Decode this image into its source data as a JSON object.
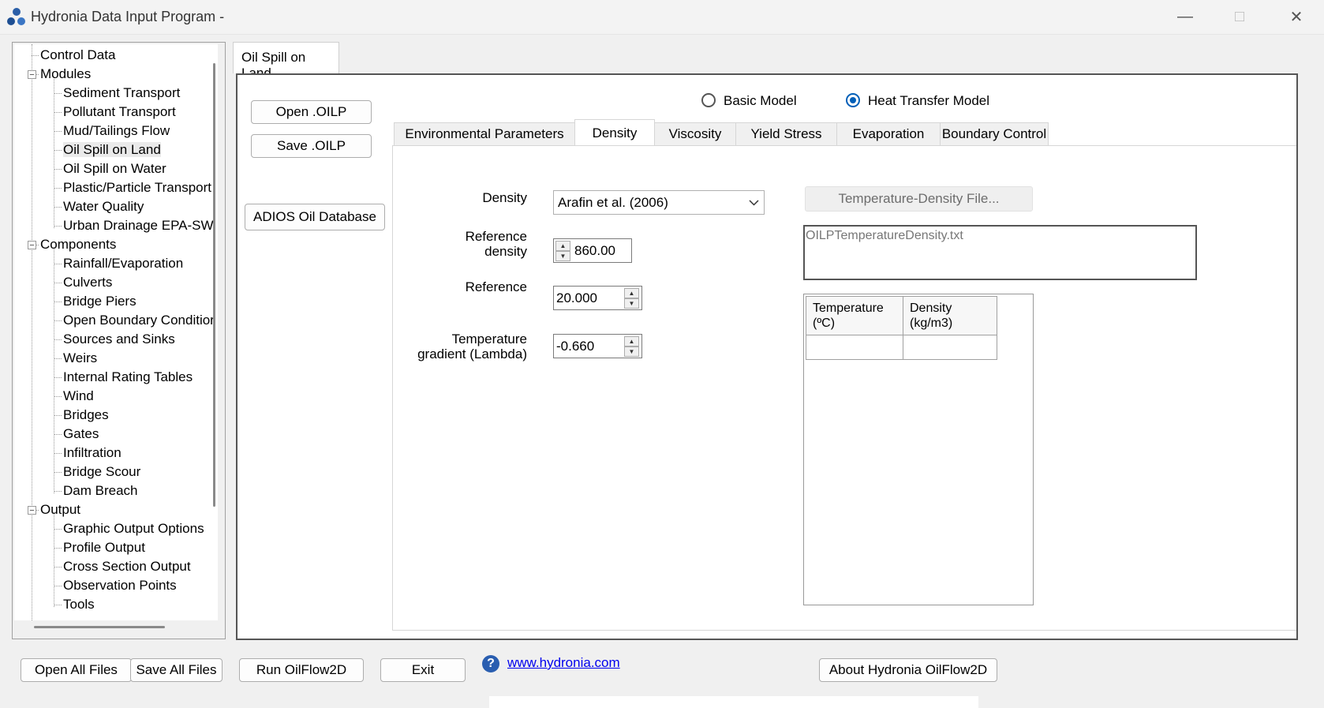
{
  "window": {
    "title": "Hydronia Data Input Program -"
  },
  "tree": [
    {
      "label": "Control Data",
      "level": 0,
      "expander": ""
    },
    {
      "label": "Modules",
      "level": 0,
      "expander": "−"
    },
    {
      "label": "Sediment Transport",
      "level": 1
    },
    {
      "label": "Pollutant Transport",
      "level": 1
    },
    {
      "label": "Mud/Tailings Flow",
      "level": 1
    },
    {
      "label": "Oil Spill on Land",
      "level": 1,
      "selected": true
    },
    {
      "label": "Oil Spill on Water",
      "level": 1
    },
    {
      "label": "Plastic/Particle Transport",
      "level": 1
    },
    {
      "label": "Water Quality",
      "level": 1
    },
    {
      "label": "Urban Drainage EPA-SW",
      "level": 1
    },
    {
      "label": "Components",
      "level": 0,
      "expander": "−"
    },
    {
      "label": "Rainfall/Evaporation",
      "level": 1
    },
    {
      "label": "Culverts",
      "level": 1
    },
    {
      "label": "Bridge Piers",
      "level": 1
    },
    {
      "label": "Open Boundary Conditior",
      "level": 1
    },
    {
      "label": "Sources and Sinks",
      "level": 1
    },
    {
      "label": "Weirs",
      "level": 1
    },
    {
      "label": "Internal Rating Tables",
      "level": 1
    },
    {
      "label": "Wind",
      "level": 1
    },
    {
      "label": "Bridges",
      "level": 1
    },
    {
      "label": "Gates",
      "level": 1
    },
    {
      "label": "Infiltration",
      "level": 1
    },
    {
      "label": "Bridge Scour",
      "level": 1
    },
    {
      "label": "Dam Breach",
      "level": 1
    },
    {
      "label": "Output",
      "level": 0,
      "expander": "−"
    },
    {
      "label": "Graphic Output Options",
      "level": 1
    },
    {
      "label": "Profile Output",
      "level": 1
    },
    {
      "label": "Cross Section Output",
      "level": 1
    },
    {
      "label": "Observation Points",
      "level": 1
    },
    {
      "label": "Tools",
      "level": 1
    }
  ],
  "main_tab": "Oil Spill on Land",
  "buttons": {
    "open_oilp": "Open .OILP",
    "save_oilp": "Save .OILP",
    "adios": "ADIOS Oil Database"
  },
  "model": {
    "basic": "Basic Model",
    "heat": "Heat Transfer Model",
    "selected": "heat"
  },
  "subtabs": [
    "Environmental Parameters",
    "Density",
    "Viscosity",
    "Yield Stress",
    "Evaporation",
    "Boundary Control"
  ],
  "active_subtab": "Density",
  "density": {
    "density_label": "Density",
    "density_value": "Arafin et al. (2006)",
    "ref_density_label_1": "Reference",
    "ref_density_label_2": "density",
    "ref_density_value": "860.00",
    "reference_label": "Reference",
    "reference_value": "20.000",
    "gradient_label_1": "Temperature",
    "gradient_label_2": "gradient (Lambda)",
    "gradient_value": "-0.660",
    "file_button": "Temperature-Density  File...",
    "file_name": "OILPTemperatureDensity.txt",
    "grid_headers": [
      {
        "line1": "Temperature",
        "line2": "(ºC)"
      },
      {
        "line1": "Density",
        "line2": "(kg/m3)"
      }
    ]
  },
  "footer": {
    "open_all": "Open All Files",
    "save_all": "Save All Files",
    "run": "Run OilFlow2D",
    "exit": "Exit",
    "link": "www.hydronia.com",
    "about": "About Hydronia OilFlow2D"
  },
  "colors": {
    "accent": "#005fb8",
    "link": "#0000ee",
    "help": "#2a5eb0"
  },
  "icons": {
    "app": "hydronia-logo-icon",
    "help": "question-circle-icon"
  }
}
